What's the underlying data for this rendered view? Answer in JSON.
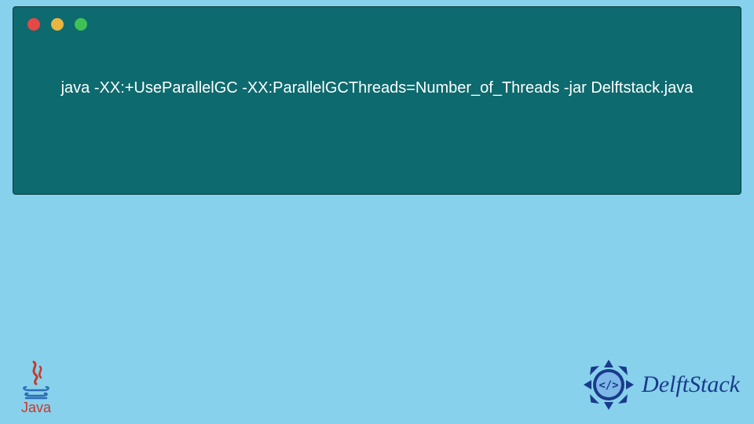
{
  "terminal": {
    "command": "java -XX:+UseParallelGC -XX:ParallelGCThreads=Number_of_Threads -jar Delftstack.java"
  },
  "logos": {
    "java_label": "Java",
    "delftstack_label": "DelftStack"
  },
  "colors": {
    "background": "#87d1ec",
    "terminal_bg": "#0d6a6e",
    "dot_red": "#e64747",
    "dot_yellow": "#e9b53f",
    "dot_green": "#3fc155",
    "java_red": "#c43a2e",
    "java_blue": "#2e6db5",
    "delft_blue": "#1a3a8a"
  }
}
